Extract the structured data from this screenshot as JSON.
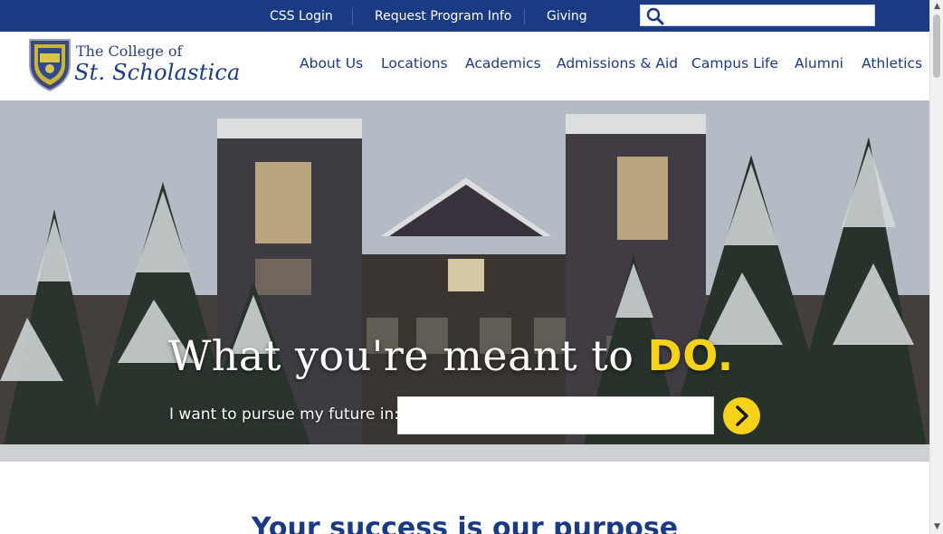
{
  "utility_bar": {
    "links": [
      "CSS Login",
      "Request Program Info",
      "Giving"
    ],
    "search_placeholder": ""
  },
  "logo": {
    "line1": "The College of",
    "line2": "St. Scholastica"
  },
  "nav": {
    "items": [
      "About Us",
      "Locations",
      "Academics",
      "Admissions & Aid",
      "Campus Life",
      "Alumni",
      "Athletics"
    ]
  },
  "hero": {
    "heading_main": "What you're meant to ",
    "heading_accent": "DO.",
    "prompt": "I want to pursue my future in:",
    "input_value": "",
    "go_icon": "chevron-right-icon"
  },
  "section": {
    "title": "Your success is our purpose"
  },
  "colors": {
    "brand_blue": "#1b3a84",
    "accent_yellow": "#f6d21b"
  }
}
